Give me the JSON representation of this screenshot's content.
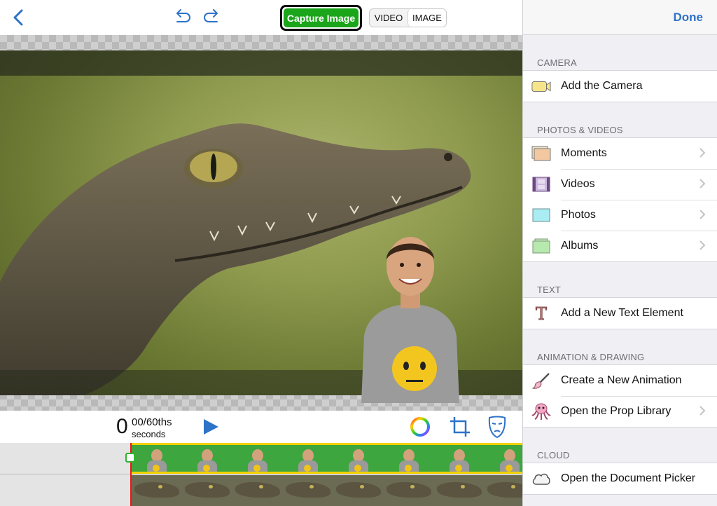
{
  "toolbar": {
    "capture_label": "Capture Image",
    "mode_video": "VIDEO",
    "mode_image": "IMAGE",
    "active_mode": "IMAGE"
  },
  "playback": {
    "time_seconds": "0",
    "time_fraction": "00/60ths",
    "time_unit": "seconds"
  },
  "panel": {
    "done_label": "Done",
    "sections": [
      {
        "title": "CAMERA",
        "items": [
          {
            "label": "Add the Camera",
            "icon": "video-camera-icon",
            "chevron": false
          }
        ]
      },
      {
        "title": "PHOTOS & VIDEOS",
        "items": [
          {
            "label": "Moments",
            "icon": "moments-icon",
            "chevron": true
          },
          {
            "label": "Videos",
            "icon": "film-strip-icon",
            "chevron": true
          },
          {
            "label": "Photos",
            "icon": "photo-icon",
            "chevron": true
          },
          {
            "label": "Albums",
            "icon": "album-stack-icon",
            "chevron": true
          }
        ]
      },
      {
        "title": "TEXT",
        "items": [
          {
            "label": "Add a New Text Element",
            "icon": "text-t-icon",
            "chevron": false
          }
        ]
      },
      {
        "title": "ANIMATION & DRAWING",
        "items": [
          {
            "label": "Create a New Animation",
            "icon": "paintbrush-icon",
            "chevron": false
          },
          {
            "label": "Open the Prop Library",
            "icon": "octopus-icon",
            "chevron": true
          }
        ]
      },
      {
        "title": "CLOUD",
        "items": [
          {
            "label": "Open the Document Picker",
            "icon": "cloud-icon",
            "chevron": false
          }
        ]
      }
    ]
  },
  "colors": {
    "accent_blue": "#2d73c8",
    "capture_green": "#1aa51a",
    "playhead_red": "#e21a1a",
    "track_border_yellow": "#f2d200"
  }
}
